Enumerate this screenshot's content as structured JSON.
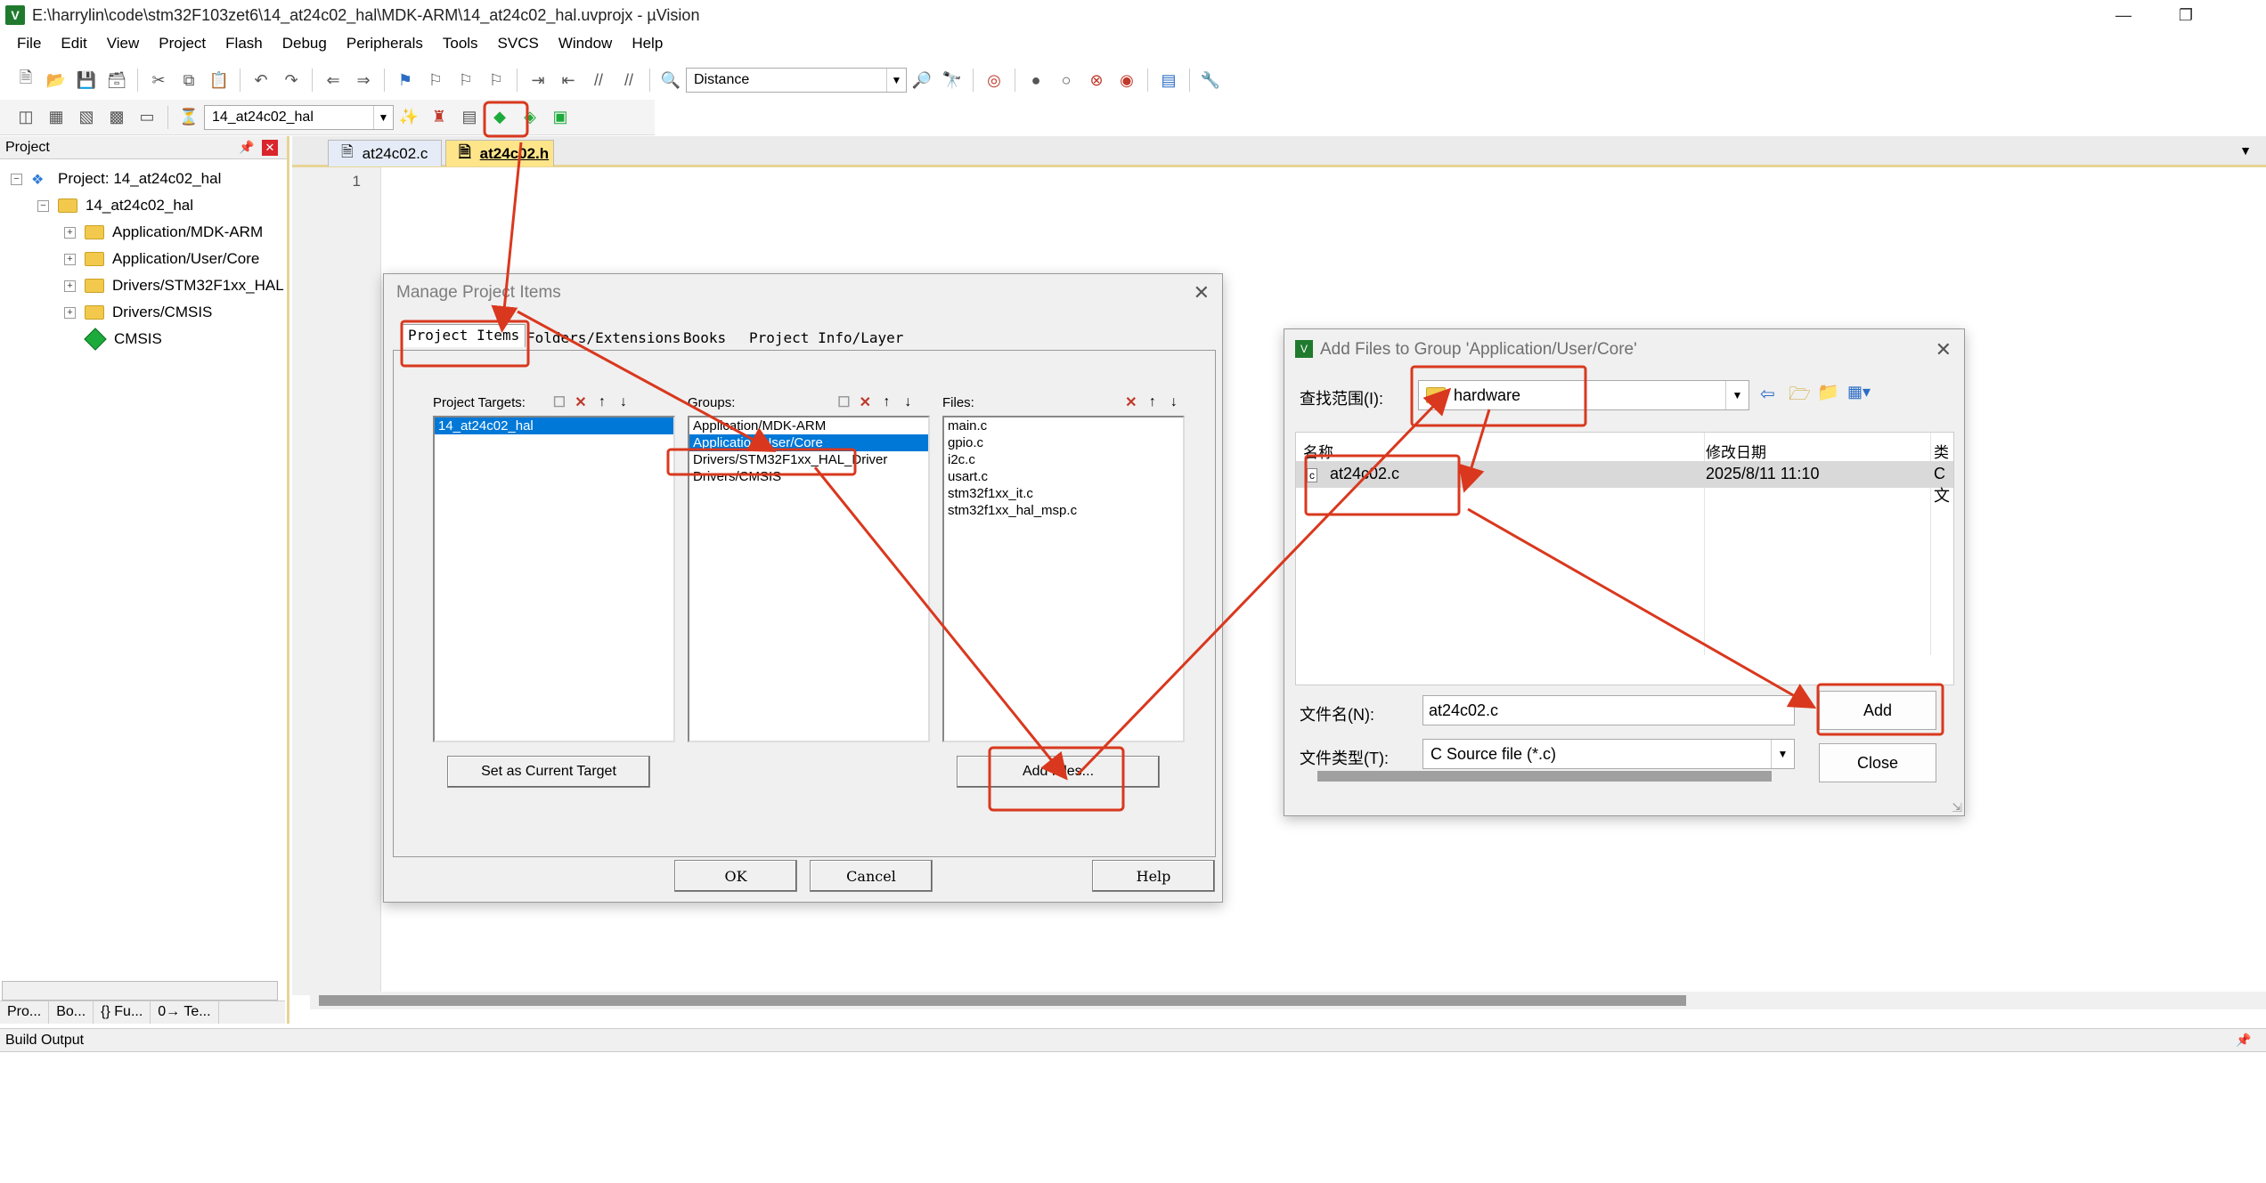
{
  "window": {
    "title": "E:\\harrylin\\code\\stm32F103zet6\\14_at24c02_hal\\MDK-ARM\\14_at24c02_hal.uvprojx - µVision",
    "app_icon": "V"
  },
  "menu": [
    "File",
    "Edit",
    "View",
    "Project",
    "Flash",
    "Debug",
    "Peripherals",
    "Tools",
    "SVCS",
    "Window",
    "Help"
  ],
  "toolbar1": {
    "find_combo_value": "Distance"
  },
  "toolbar2": {
    "target_combo_value": "14_at24c02_hal"
  },
  "project_panel": {
    "header": "Project",
    "root": "Project: 14_at24c02_hal",
    "target": "14_at24c02_hal",
    "groups": [
      "Application/MDK-ARM",
      "Application/User/Core",
      "Drivers/STM32F1xx_HAL",
      "Drivers/CMSIS"
    ],
    "cmsis": "CMSIS",
    "tabs": [
      "Pro...",
      "Bo...",
      "{} Fu...",
      "0→ Te..."
    ]
  },
  "editor": {
    "tabs": [
      "at24c02.c",
      "at24c02.h"
    ],
    "line_number": "1"
  },
  "build_output": {
    "header": "Build Output"
  },
  "manage_dialog": {
    "title": "Manage Project Items",
    "tabs": [
      "Project Items",
      "Folders/Extensions",
      "Books",
      "Project Info/Layer"
    ],
    "targets_label": "Project Targets:",
    "groups_label": "Groups:",
    "files_label": "Files:",
    "targets": [
      "14_at24c02_hal"
    ],
    "groups": [
      "Application/MDK-ARM",
      "Application/User/Core",
      "Drivers/STM32F1xx_HAL_Driver",
      "Drivers/CMSIS"
    ],
    "files": [
      "main.c",
      "gpio.c",
      "i2c.c",
      "usart.c",
      "stm32f1xx_it.c",
      "stm32f1xx_hal_msp.c"
    ],
    "set_current_target": "Set as Current Target",
    "add_files": "Add Files...",
    "ok": "OK",
    "cancel": "Cancel",
    "help": "Help"
  },
  "add_files_dialog": {
    "title": "Add Files to Group 'Application/User/Core'",
    "look_in_label": "查找范围(I):",
    "look_in_value": "hardware",
    "col_name": "名称",
    "col_date": "修改日期",
    "col_type": "类",
    "file_name": "at24c02.c",
    "file_date": "2025/8/11 11:10",
    "file_type_short": "C 文",
    "filename_label": "文件名(N):",
    "filename_value": "at24c02.c",
    "filetype_label": "文件类型(T):",
    "filetype_value": "C Source file (*.c)",
    "add": "Add",
    "close": "Close"
  },
  "colors": {
    "annotation_red": "#d9381e",
    "selection_blue": "#0078d7",
    "active_tab": "#ffe58a"
  }
}
